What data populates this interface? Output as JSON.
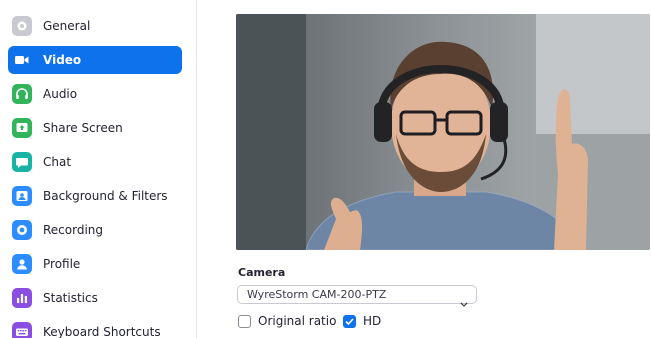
{
  "sidebar": {
    "items": [
      {
        "label": "General",
        "icon": "gear-icon",
        "color": "#c9c9d1",
        "active": false
      },
      {
        "label": "Video",
        "icon": "video-camera-icon",
        "color": "#0e72ed",
        "active": true
      },
      {
        "label": "Audio",
        "icon": "headphones-icon",
        "color": "#33b35a",
        "active": false
      },
      {
        "label": "Share Screen",
        "icon": "share-screen-icon",
        "color": "#33b35a",
        "active": false
      },
      {
        "label": "Chat",
        "icon": "chat-bubble-icon",
        "color": "#19b3a6",
        "active": false
      },
      {
        "label": "Background & Filters",
        "icon": "background-icon",
        "color": "#2d8cff",
        "active": false
      },
      {
        "label": "Recording",
        "icon": "record-icon",
        "color": "#2d8cff",
        "active": false
      },
      {
        "label": "Profile",
        "icon": "profile-icon",
        "color": "#2d8cff",
        "active": false
      },
      {
        "label": "Statistics",
        "icon": "statistics-icon",
        "color": "#8a4fe0",
        "active": false
      },
      {
        "label": "Keyboard Shortcuts",
        "icon": "keyboard-icon",
        "color": "#8a4fe0",
        "active": false
      }
    ]
  },
  "video": {
    "camera_label": "Camera",
    "camera_value": "WyreStorm CAM-200-PTZ",
    "original_ratio_label": "Original ratio",
    "original_ratio_checked": false,
    "hd_label": "HD",
    "hd_checked": true
  },
  "colors": {
    "accent": "#0e72ed",
    "text": "#232333"
  }
}
